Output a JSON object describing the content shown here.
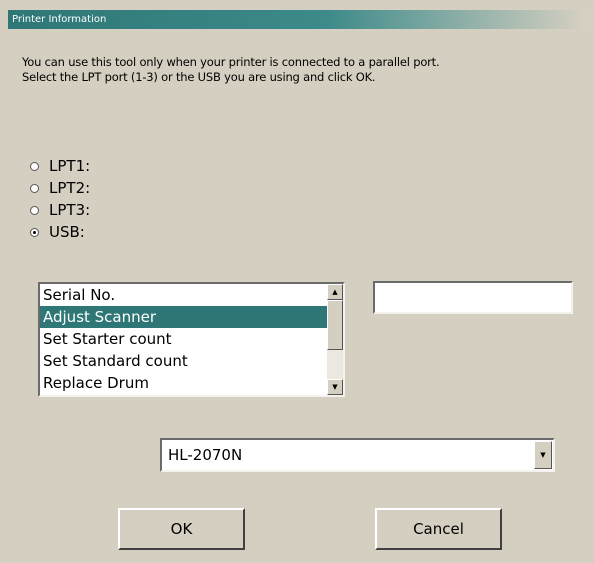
{
  "window": {
    "title": "Printer Information"
  },
  "instructions": {
    "line1": "You can use this tool only when your printer is connected to a parallel port.",
    "line2": "Select the LPT port (1-3) or the USB you are using and click OK."
  },
  "ports": [
    {
      "label": "LPT1:",
      "checked": false
    },
    {
      "label": "LPT2:",
      "checked": false
    },
    {
      "label": "LPT3:",
      "checked": false
    },
    {
      "label": "USB:",
      "checked": true
    }
  ],
  "function_list": {
    "items": [
      "Serial No.",
      "Adjust Scanner",
      "Set Starter count",
      "Set Standard count",
      "Replace Drum"
    ],
    "selected": "Adjust Scanner"
  },
  "serial_field": {
    "value": ""
  },
  "model_select": {
    "value": "HL-2070N"
  },
  "buttons": {
    "ok": "OK",
    "cancel": "Cancel"
  },
  "icons": {
    "scroll_up": "up-arrow-icon",
    "scroll_down": "down-arrow-icon",
    "dropdown": "down-arrow-icon"
  }
}
